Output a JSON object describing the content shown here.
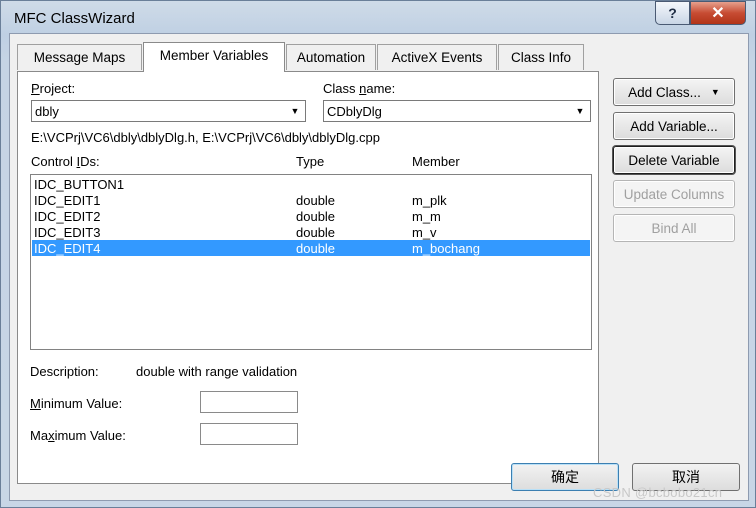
{
  "window": {
    "title": "MFC ClassWizard",
    "help_label": "?",
    "close_label": "✕"
  },
  "tabs": [
    {
      "label": "Message Maps"
    },
    {
      "label": "Member Variables"
    },
    {
      "label": "Automation"
    },
    {
      "label": "ActiveX Events"
    },
    {
      "label": "Class Info"
    }
  ],
  "project": {
    "label_key": "P",
    "label_rest": "roject:",
    "value": "dbly"
  },
  "class_name": {
    "label_pre": "Class ",
    "label_key": "n",
    "label_rest": "ame:",
    "value": "CDblyDlg"
  },
  "files_path": "E:\\VCPrj\\VC6\\dbly\\dblyDlg.h, E:\\VCPrj\\VC6\\dbly\\dblyDlg.cpp",
  "list": {
    "headers": {
      "control_ids_pre": "Control ",
      "control_ids_key": "I",
      "control_ids_rest": "Ds:",
      "type": "Type",
      "member": "Member"
    },
    "rows": [
      {
        "id": "IDC_BUTTON1",
        "type": "",
        "member": ""
      },
      {
        "id": "IDC_EDIT1",
        "type": "double",
        "member": "m_plk"
      },
      {
        "id": "IDC_EDIT2",
        "type": "double",
        "member": "m_m"
      },
      {
        "id": "IDC_EDIT3",
        "type": "double",
        "member": "m_v"
      },
      {
        "id": "IDC_EDIT4",
        "type": "double",
        "member": "m_bochang"
      }
    ],
    "selected_index": 4
  },
  "description": {
    "label": "Description:",
    "value": "double with range validation"
  },
  "min_value": {
    "label_key": "M",
    "label_rest": "inimum Value:",
    "value": ""
  },
  "max_value": {
    "label_pre": "Ma",
    "label_key": "x",
    "label_rest": "imum Value:",
    "value": ""
  },
  "side_buttons": {
    "add_class": "Add Class...",
    "add_variable": "Add Variable...",
    "delete_variable": "Delete Variable",
    "update_columns": "Update Columns",
    "bind_all": "Bind All"
  },
  "dialog_buttons": {
    "ok": "确定",
    "cancel": "取消"
  },
  "watermark": "CSDN @bcbobo21cn",
  "colors": {
    "selection": "#3399ff",
    "close_button": "#c74c33"
  }
}
